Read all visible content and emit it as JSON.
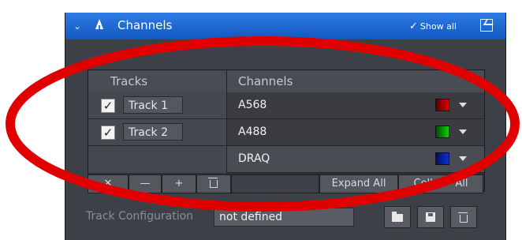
{
  "window": {
    "title": "Channels",
    "show_all_label": "Show all"
  },
  "table": {
    "headers": {
      "tracks": "Tracks",
      "channels": "Channels"
    },
    "tracks": [
      {
        "name": "Track 1",
        "checked": true
      },
      {
        "name": "Track 2",
        "checked": true
      }
    ],
    "channels": [
      {
        "name": "A568",
        "color": "#d00000"
      },
      {
        "name": "A488",
        "color": "#10c010"
      },
      {
        "name": "DRAQ",
        "color": "#1030d0"
      }
    ]
  },
  "toolbar": {
    "add_label": "+",
    "expand_all_label": "Expand All",
    "collapse_all_label": "Colla     All"
  },
  "config": {
    "label": "Track Configuration",
    "value": "not defined"
  },
  "highlight": {
    "color": "#e00000"
  }
}
